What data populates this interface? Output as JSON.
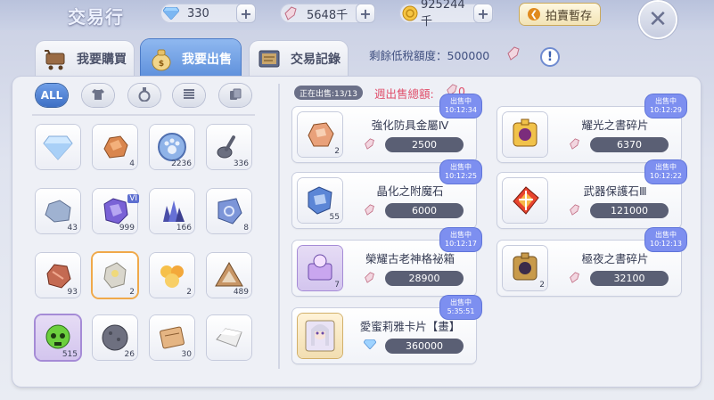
{
  "header": {
    "title": "交易行",
    "gems": "330",
    "fragments": "5648千",
    "gold": "925244千",
    "pawn_button": "拍賣暫存"
  },
  "tabs": [
    {
      "label": "我要購買",
      "active": false
    },
    {
      "label": "我要出售",
      "active": true
    },
    {
      "label": "交易記錄",
      "active": false
    }
  ],
  "tax": {
    "label": "剩餘低稅額度：",
    "value": "500000"
  },
  "filters": [
    "ALL",
    "shirt-icon",
    "potion-icon",
    "spring-icon",
    "cards-icon"
  ],
  "inventory": [
    {
      "icon": "diamond-icon",
      "count": ""
    },
    {
      "icon": "ore-icon",
      "count": "4"
    },
    {
      "icon": "paw-coin-icon",
      "count": "2236"
    },
    {
      "icon": "ladle-icon",
      "count": "336"
    },
    {
      "icon": "rock-icon",
      "count": "43"
    },
    {
      "icon": "crystal-icon",
      "count": "999",
      "badge": "VI"
    },
    {
      "icon": "gem-cluster-icon",
      "count": "166"
    },
    {
      "icon": "rune-stone-icon",
      "count": "8"
    },
    {
      "icon": "red-ore-icon",
      "count": "93"
    },
    {
      "icon": "metal-icon",
      "count": "2"
    },
    {
      "icon": "flower-icon",
      "count": "2"
    },
    {
      "icon": "triangle-icon",
      "count": "489"
    },
    {
      "icon": "skull-icon",
      "count": "515"
    },
    {
      "icon": "ball-icon",
      "count": "26"
    },
    {
      "icon": "brick-icon",
      "count": "30"
    },
    {
      "icon": "slab-icon",
      "count": ""
    }
  ],
  "selling": {
    "badge": "正在出售:13/13",
    "week_label": "週出售總額:",
    "week_value": "0"
  },
  "listings": [
    {
      "name": "強化防具金屬Ⅳ",
      "price": "2500",
      "currency": "fragment",
      "count": "2",
      "status": "出售中",
      "time": "10:12:34"
    },
    {
      "name": "耀光之書碎片",
      "price": "6370",
      "currency": "fragment",
      "count": "",
      "status": "出售中",
      "time": "10:12:29"
    },
    {
      "name": "晶化之附魔石",
      "price": "6000",
      "currency": "fragment",
      "count": "55",
      "status": "出售中",
      "time": "10:12:25"
    },
    {
      "name": "武器保護石Ⅲ",
      "price": "121000",
      "currency": "fragment",
      "count": "",
      "status": "出售中",
      "time": "10:12:22"
    },
    {
      "name": "榮耀古老神格祕箱",
      "price": "28900",
      "currency": "fragment",
      "count": "7",
      "status": "出售中",
      "time": "10:12:17"
    },
    {
      "name": "極夜之書碎片",
      "price": "32100",
      "currency": "fragment",
      "count": "2",
      "status": "出售中",
      "time": "10:12:13"
    },
    {
      "name": "愛蜜莉雅卡片【畫】",
      "price": "360000",
      "currency": "diamond",
      "count": "",
      "status": "出售中",
      "time": "5:35:51"
    }
  ],
  "colors": {
    "accent_blue": "#5d8fdb",
    "price_bg": "#5a5f74",
    "sale_tag": "#7d8ff0",
    "week_red": "#e04f6b"
  }
}
